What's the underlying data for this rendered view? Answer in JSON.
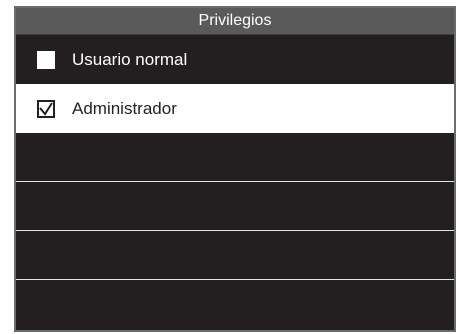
{
  "screen": {
    "title": "Privilegios"
  },
  "options": [
    {
      "label": "Usuario normal",
      "checked": false
    },
    {
      "label": "Administrador",
      "checked": true
    }
  ],
  "colors": {
    "background": "#231f20",
    "title_bar": "#5a5a5a",
    "selected_row": "#ffffff",
    "text_light": "#ffffff",
    "text_dark": "#231f20"
  }
}
